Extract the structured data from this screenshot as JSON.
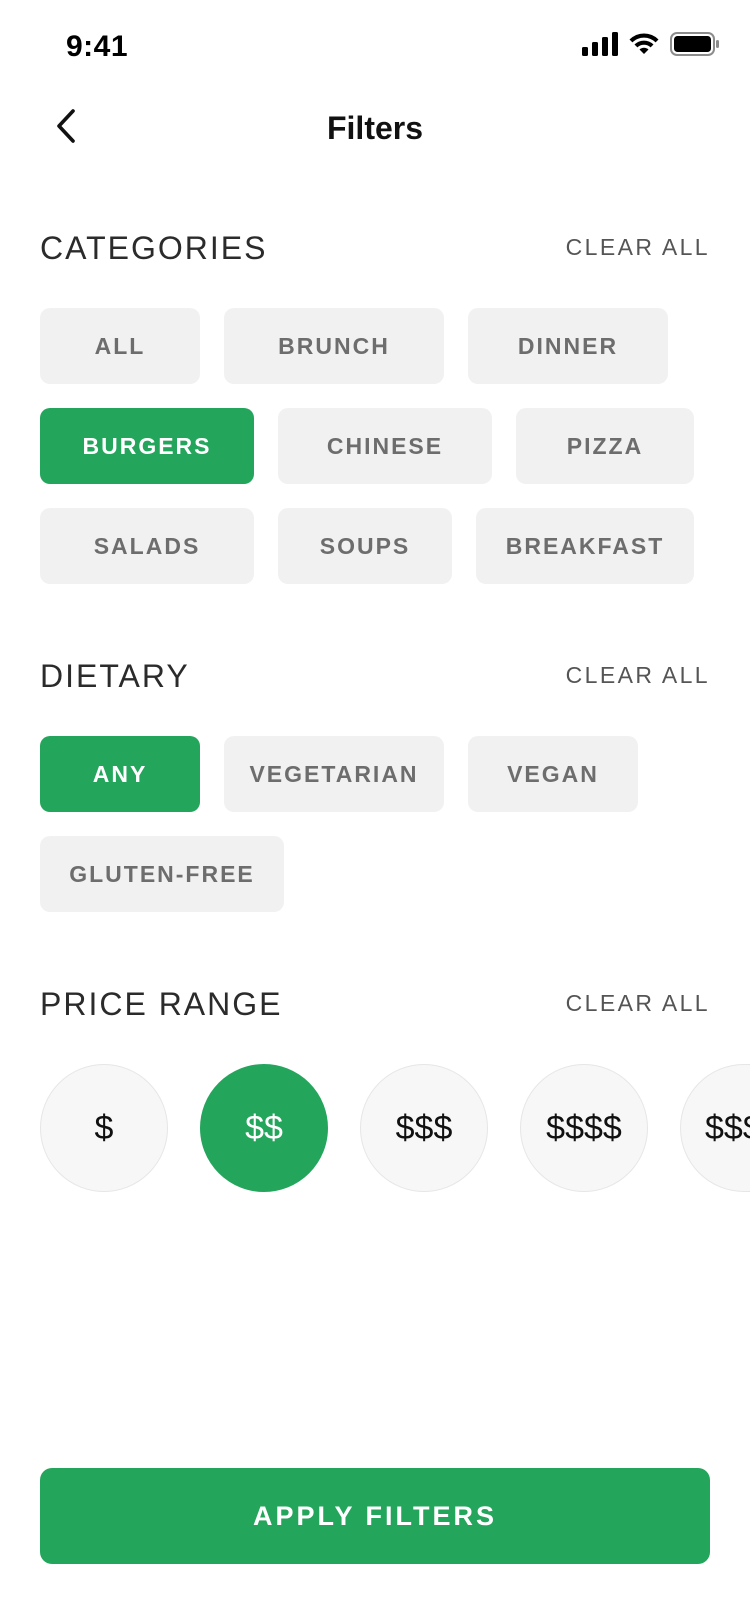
{
  "status_bar": {
    "time": "9:41"
  },
  "nav": {
    "title": "Filters",
    "back_icon": "chevron-left-icon"
  },
  "categories": {
    "title": "CATEGORIES",
    "clear_label": "CLEAR ALL",
    "items": [
      {
        "label": "ALL",
        "selected": false
      },
      {
        "label": "BRUNCH",
        "selected": false
      },
      {
        "label": "DINNER",
        "selected": false
      },
      {
        "label": "BURGERS",
        "selected": true
      },
      {
        "label": "CHINESE",
        "selected": false
      },
      {
        "label": "PIZZA",
        "selected": false
      },
      {
        "label": "SALADS",
        "selected": false
      },
      {
        "label": "SOUPS",
        "selected": false
      },
      {
        "label": "BREAKFAST",
        "selected": false
      }
    ]
  },
  "dietary": {
    "title": "DIETARY",
    "clear_label": "CLEAR ALL",
    "items": [
      {
        "label": "ANY",
        "selected": true
      },
      {
        "label": "VEGETARIAN",
        "selected": false
      },
      {
        "label": "VEGAN",
        "selected": false
      },
      {
        "label": "GLUTEN-FREE",
        "selected": false
      }
    ]
  },
  "price_range": {
    "title": "PRICE RANGE",
    "clear_label": "CLEAR ALL",
    "items": [
      {
        "label": "$",
        "selected": false
      },
      {
        "label": "$$",
        "selected": true
      },
      {
        "label": "$$$",
        "selected": false
      },
      {
        "label": "$$$$",
        "selected": false
      },
      {
        "label": "$$$$$",
        "selected": false
      }
    ]
  },
  "apply_button": {
    "label": "APPLY FILTERS"
  },
  "colors": {
    "accent": "#24a55c",
    "chip_background": "#f1f1f1",
    "chip_text": "#6d6d6d"
  }
}
